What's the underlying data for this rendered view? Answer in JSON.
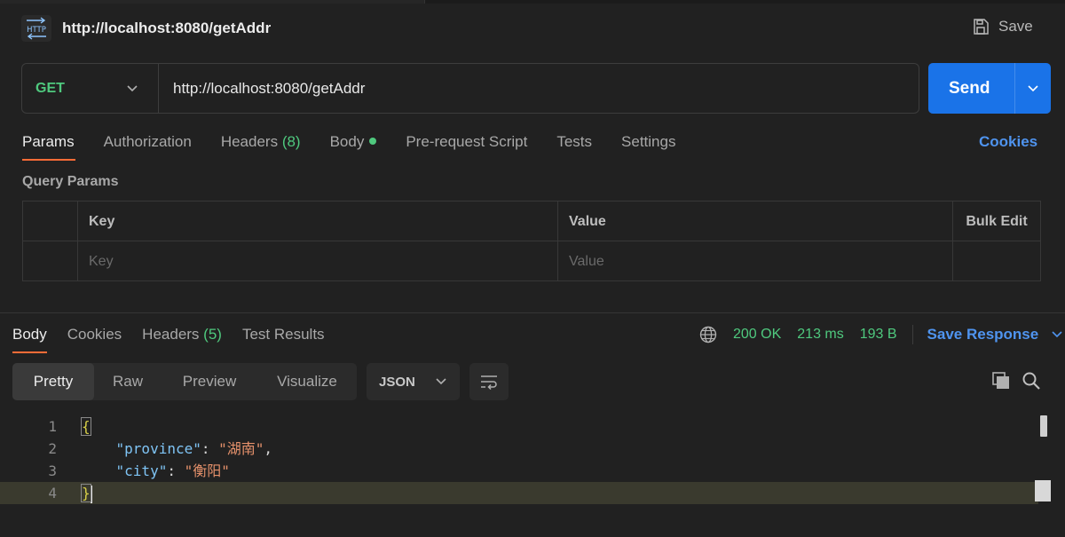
{
  "header": {
    "icon_name": "http-icon",
    "icon_text": "HTTP",
    "title": "http://localhost:8080/getAddr",
    "save_label": "Save"
  },
  "request": {
    "method": "GET",
    "url": "http://localhost:8080/getAddr",
    "send_label": "Send"
  },
  "request_tabs": {
    "params": "Params",
    "authorization": "Authorization",
    "headers": "Headers",
    "headers_count": "(8)",
    "body": "Body",
    "prerequest": "Pre-request Script",
    "tests": "Tests",
    "settings": "Settings",
    "cookies": "Cookies"
  },
  "query_params": {
    "title": "Query Params",
    "col_key": "Key",
    "col_value": "Value",
    "bulk_edit": "Bulk Edit",
    "key_placeholder": "Key",
    "value_placeholder": "Value"
  },
  "response_tabs": {
    "body": "Body",
    "cookies": "Cookies",
    "headers": "Headers",
    "headers_count": "(5)",
    "test_results": "Test Results"
  },
  "response_status": {
    "status": "200 OK",
    "time": "213 ms",
    "size": "193 B",
    "save_response": "Save Response"
  },
  "viewer": {
    "modes": [
      "Pretty",
      "Raw",
      "Preview",
      "Visualize"
    ],
    "format": "JSON"
  },
  "code": {
    "line_numbers": [
      "1",
      "2",
      "3",
      "4"
    ],
    "open_brace": "{",
    "close_brace": "}",
    "key1": "\"province\"",
    "val1": "\"湖南\"",
    "key2": "\"city\"",
    "val2": "\"衡阳\""
  },
  "colors": {
    "accent": "#ff6c37",
    "send": "#1a73e8",
    "link": "#4f94ef",
    "success": "#4fc97e"
  }
}
